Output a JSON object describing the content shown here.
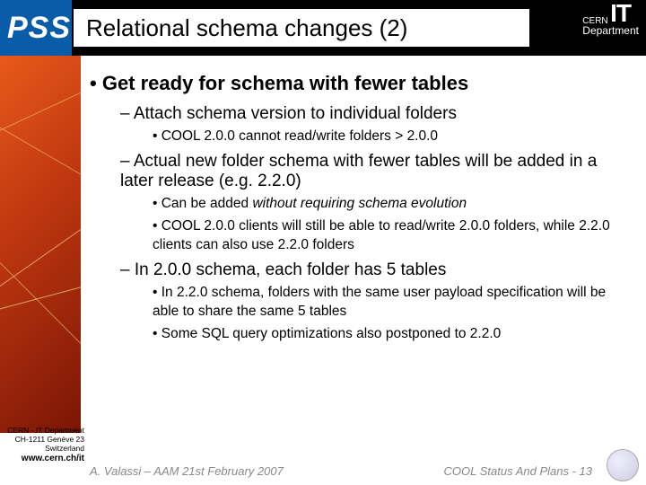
{
  "header": {
    "pss": "PSS",
    "title": "Relational schema changes (2)",
    "cern": "CERN",
    "it": "IT",
    "dept": "Department"
  },
  "content": {
    "h1": "Get ready for schema with fewer tables",
    "s1": "Attach schema version to individual folders",
    "s1_1": "COOL 2.0.0 cannot read/write folders > 2.0.0",
    "s2": "Actual new folder schema with fewer tables will be added in a later release (e.g. 2.2.0)",
    "s2_1a": "Can be added ",
    "s2_1b": "without requiring schema evolution",
    "s2_2": "COOL 2.0.0 clients will still be able to read/write 2.0.0 folders, while 2.2.0 clients can also use 2.2.0 folders",
    "s3": "In 2.0.0 schema, each folder has 5 tables",
    "s3_1": "In 2.2.0 schema, folders with the same user payload specification will be able to share the same 5 tables",
    "s3_2": "Some SQL query optimizations also postponed to 2.2.0"
  },
  "footer": {
    "addr1": "CERN - IT Department",
    "addr2": "CH-1211 Genève 23",
    "addr3": "Switzerland",
    "url": "www.cern.ch/it",
    "left": "A. Valassi – AAM 21st February 2007",
    "right": "COOL Status And Plans - 13"
  }
}
